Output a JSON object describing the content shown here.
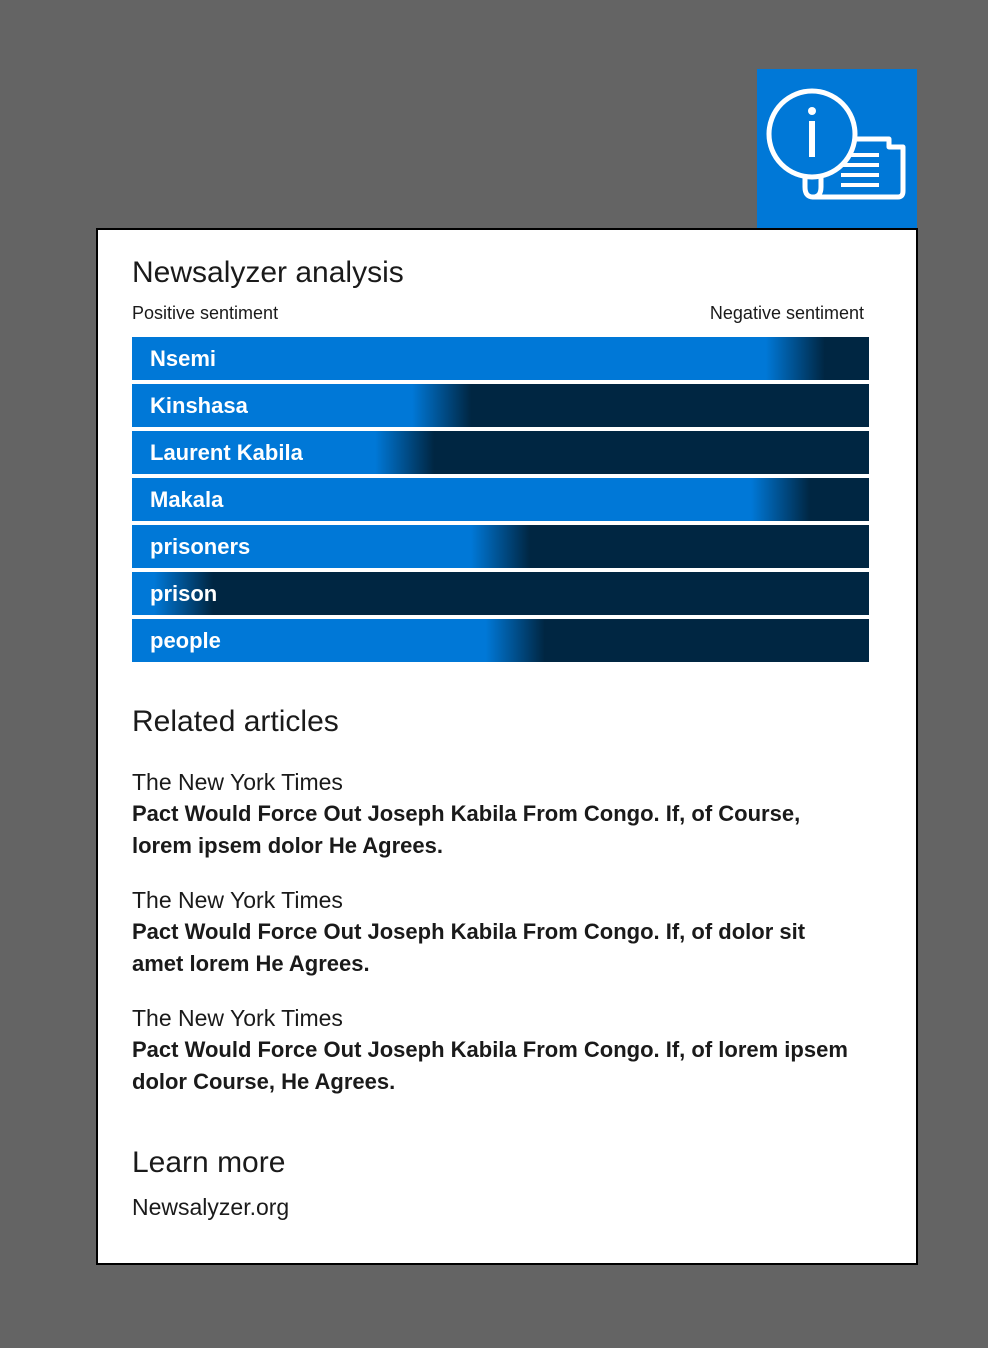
{
  "tile": {
    "icon": "info-newspaper-icon",
    "color": "#0078d7"
  },
  "analysis": {
    "title": "Newsalyzer analysis",
    "positive_label": "Positive sentiment",
    "negative_label": "Negative sentiment",
    "positive_color": "#0078d7",
    "negative_color": "#002642",
    "entities": [
      {
        "label": "Nsemi",
        "positive_fraction": 0.9
      },
      {
        "label": "Kinshasa",
        "positive_fraction": 0.42
      },
      {
        "label": "Laurent Kabila",
        "positive_fraction": 0.37
      },
      {
        "label": "Makala",
        "positive_fraction": 0.88
      },
      {
        "label": "prisoners",
        "positive_fraction": 0.5
      },
      {
        "label": "prison",
        "positive_fraction": 0.07
      },
      {
        "label": "people",
        "positive_fraction": 0.52
      }
    ]
  },
  "related": {
    "title": "Related articles",
    "articles": [
      {
        "source": "The New York Times",
        "headline": "Pact Would Force Out Joseph Kabila From Congo. If, of Course, lorem ipsem dolor He Agrees."
      },
      {
        "source": "The New York Times",
        "headline": "Pact Would Force Out Joseph Kabila From Congo. If, of dolor sit amet lorem He Agrees."
      },
      {
        "source": "The New York Times",
        "headline": "Pact Would Force Out Joseph Kabila From Congo. If, of lorem ipsem dolor Course, He Agrees."
      }
    ]
  },
  "learn_more": {
    "title": "Learn more",
    "link": "Newsalyzer.org"
  }
}
